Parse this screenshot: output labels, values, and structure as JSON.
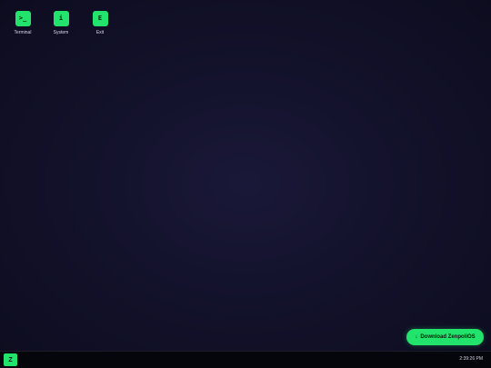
{
  "desktop": {
    "icons": [
      {
        "glyph": ">_",
        "label": "Terminal",
        "icon": "terminal-icon"
      },
      {
        "glyph": "i",
        "label": "System",
        "icon": "info-icon"
      },
      {
        "glyph": "E",
        "label": "Exit",
        "icon": "exit-icon"
      }
    ],
    "download_button": {
      "icon": "↓",
      "label": "Download ZenpoliOS"
    }
  },
  "taskbar": {
    "start_label": "Z",
    "clock": "2:39:26 PM"
  },
  "colors": {
    "accent": "#22e36b",
    "background": "#13122b",
    "taskbar": "#05050c"
  }
}
